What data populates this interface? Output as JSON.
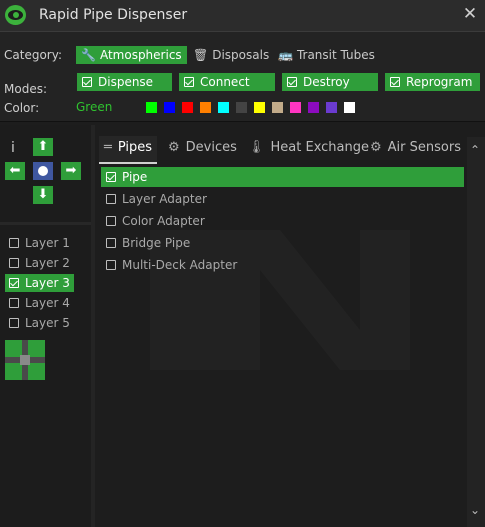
{
  "window": {
    "title": "Rapid Pipe Dispenser",
    "close": "✕"
  },
  "category": {
    "label": "Category:",
    "items": [
      "Atmospherics",
      "Disposals",
      "Transit Tubes"
    ]
  },
  "modes": {
    "label": "Modes:",
    "items": [
      "Dispense",
      "Connect",
      "Destroy",
      "Reprogram"
    ]
  },
  "color": {
    "label": "Color:",
    "value": "Green",
    "swatches": [
      "#00ff00",
      "#0000ff",
      "#ff0000",
      "#ff7f00",
      "#00ffff",
      "#444444",
      "#ffff00",
      "#c2ab8a",
      "#ff35c1",
      "#8c0bbf",
      "#6b3bd0",
      "#ffffff"
    ]
  },
  "tabs": [
    {
      "label": "Pipes",
      "icon": "pipes-icon"
    },
    {
      "label": "Devices",
      "icon": "gear-icon"
    },
    {
      "label": "Heat Exchange",
      "icon": "thermometer-icon"
    },
    {
      "label": "Air Sensors",
      "icon": "sensor-icon"
    }
  ],
  "items": [
    "Pipe",
    "Layer Adapter",
    "Color Adapter",
    "Bridge Pipe",
    "Multi-Deck Adapter"
  ],
  "layers": [
    "Layer 1",
    "Layer 2",
    "Layer 3",
    "Layer 4",
    "Layer 5"
  ],
  "info_symbol": "i",
  "accent": "#2f9e3a"
}
